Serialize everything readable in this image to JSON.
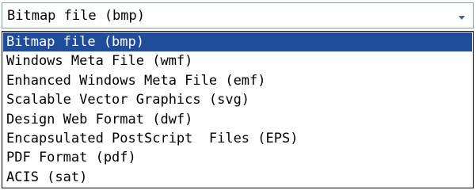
{
  "combo": {
    "value": "Bitmap file (bmp)",
    "arrow_icon": "chevron-down-icon"
  },
  "dropdown": {
    "selected_index": 0,
    "options": [
      "Bitmap file (bmp)",
      "Windows Meta File (wmf)",
      "Enhanced Windows Meta File (emf)",
      "Scalable Vector Graphics (svg)",
      "Design Web Format (dwf)",
      "Encapsulated PostScript  Files (EPS)",
      "PDF Format (pdf)",
      "ACIS (sat)"
    ]
  },
  "colors": {
    "selection_bg": "#1f4d9c",
    "selection_text": "#ffffff",
    "combo_border": "#7f9db9"
  }
}
